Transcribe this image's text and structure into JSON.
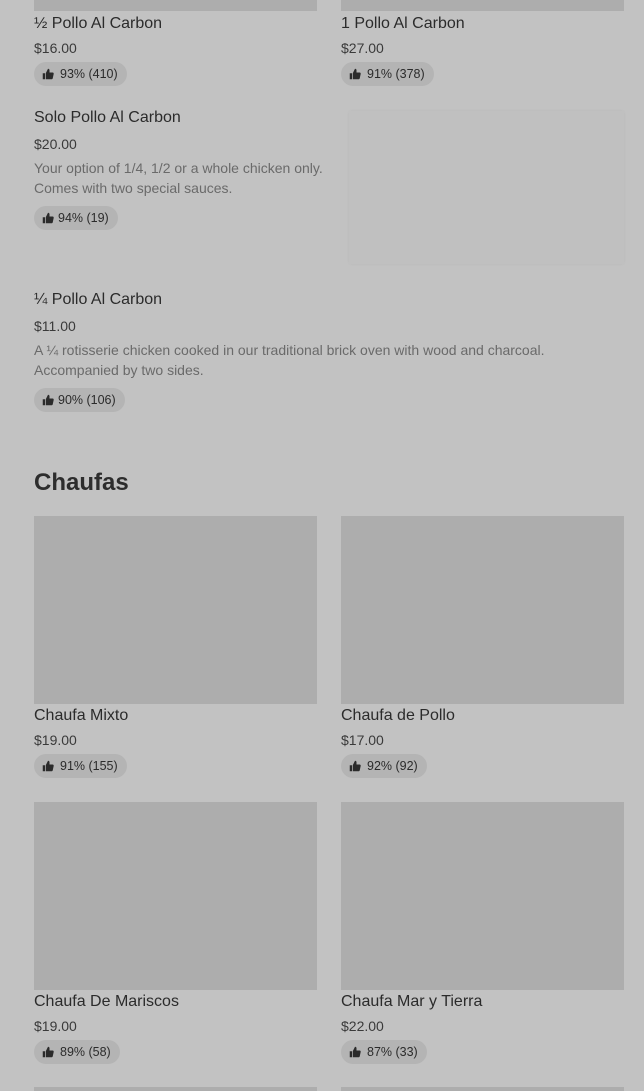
{
  "items_top": [
    {
      "name": "½ Pollo Al Carbon",
      "price": "$16.00",
      "rating": "93% (410)"
    },
    {
      "name": "1 Pollo Al Carbon",
      "price": "$27.00",
      "rating": "91% (378)"
    }
  ],
  "solo": {
    "name": "Solo Pollo Al Carbon",
    "price": "$20.00",
    "description": "Your option of 1/4, 1/2 or a whole chicken only. Comes with two special sauces.",
    "rating": "94% (19)"
  },
  "quarter": {
    "name": "¼ Pollo Al Carbon",
    "price": "$11.00",
    "description": "A ¼ rotisserie chicken cooked in our traditional brick oven with wood and charcoal. Accompanied by two sides.",
    "rating": "90% (106)"
  },
  "section": {
    "title": "Chaufas"
  },
  "chaufas": [
    {
      "name": "Chaufa Mixto",
      "price": "$19.00",
      "rating": "91% (155)"
    },
    {
      "name": "Chaufa de Pollo",
      "price": "$17.00",
      "rating": "92% (92)"
    },
    {
      "name": "Chaufa De Mariscos",
      "price": "$19.00",
      "rating": "89% (58)"
    },
    {
      "name": "Chaufa Mar y Tierra",
      "price": "$22.00",
      "rating": "87% (33)"
    }
  ],
  "icons": {
    "rating": "thumbs-up-icon"
  }
}
